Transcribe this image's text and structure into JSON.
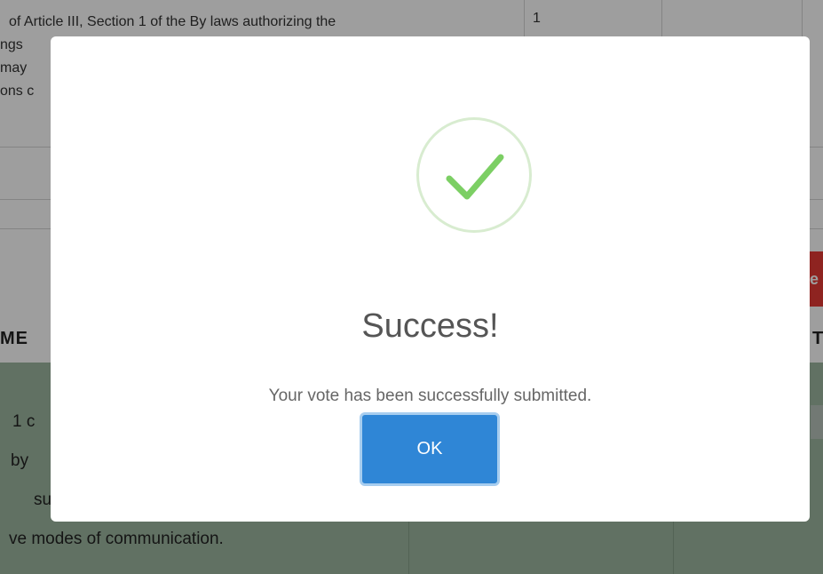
{
  "background": {
    "article_lines": [
      "of Article III, Section 1 of the By laws authorizing the",
      "ngs",
      "may",
      "ons c"
    ],
    "count_cell": "1",
    "red_button_label": "e",
    "header_left": "ME",
    "header_right": "T",
    "motion_lines": [
      "1 c",
      "by",
      "su",
      "ve modes of communication."
    ]
  },
  "modal": {
    "title": "Success!",
    "message": "Your vote has been successfully submitted.",
    "ok_label": "OK",
    "icon": "checkmark-circle-icon"
  },
  "colors": {
    "success_green": "#7ccf64",
    "success_ring": "#d8ecd0",
    "ok_button": "#2f86d6",
    "overlay": "rgba(0,0,0,0.38)",
    "danger_red": "#e53935"
  }
}
